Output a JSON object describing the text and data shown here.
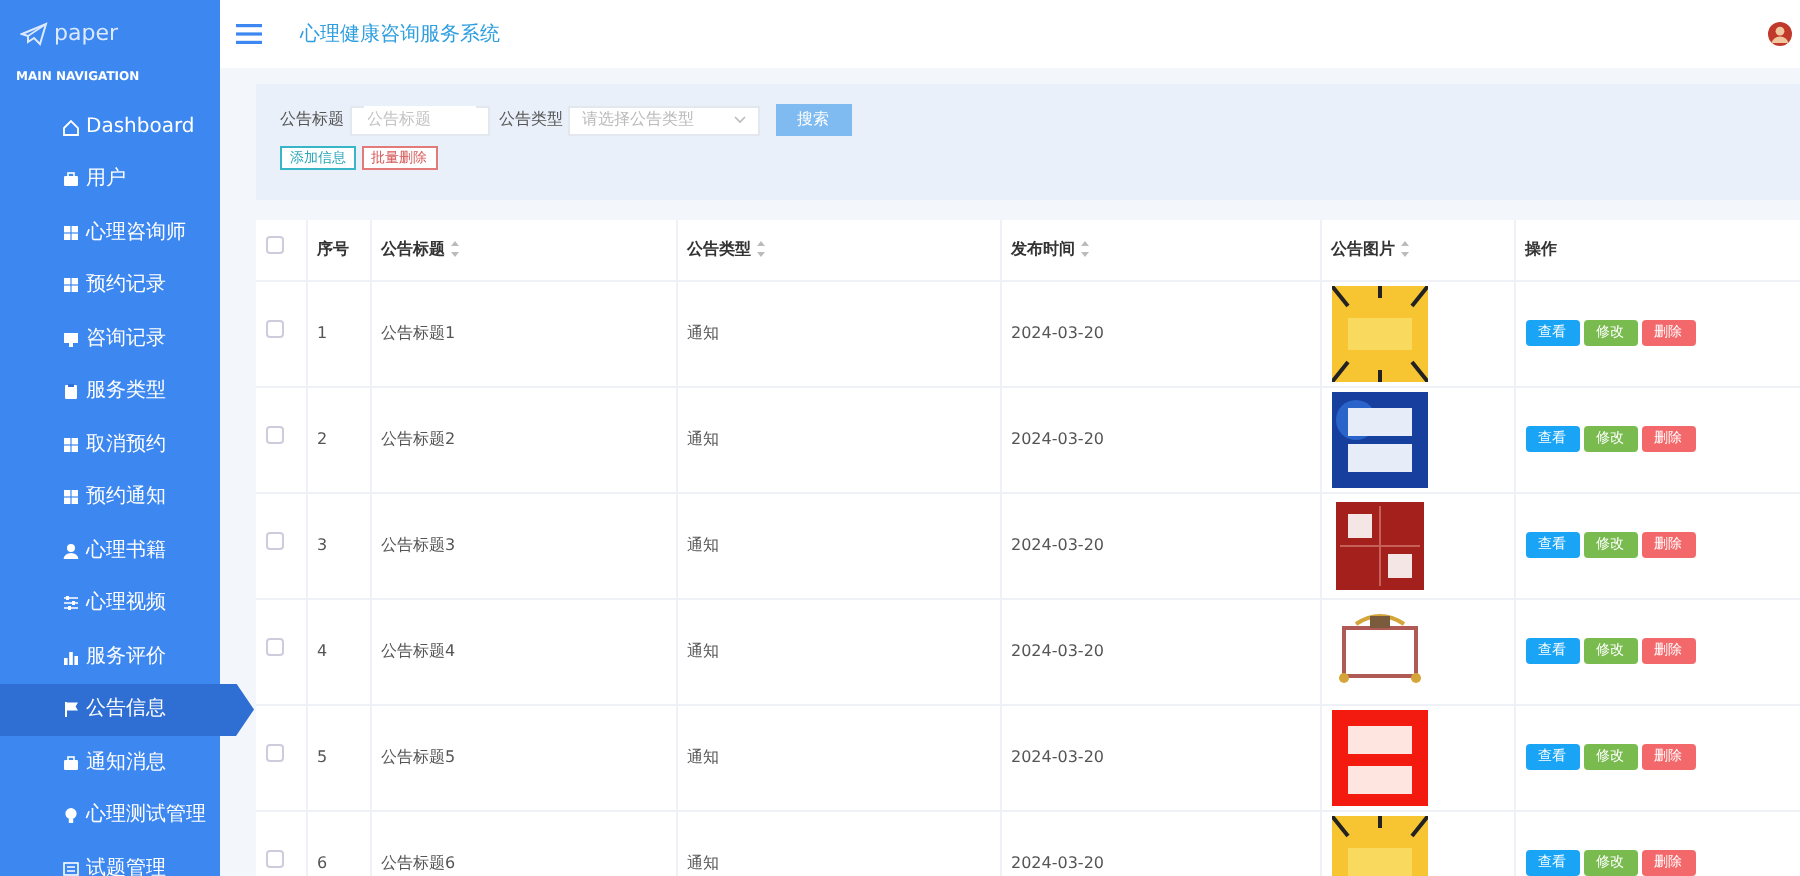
{
  "brand": "paper",
  "nav_heading": "MAIN NAVIGATION",
  "sidebar": {
    "items": [
      {
        "label": "Dashboard",
        "selected": false
      },
      {
        "label": "用户",
        "selected": false
      },
      {
        "label": "心理咨询师",
        "selected": false
      },
      {
        "label": "预约记录",
        "selected": false
      },
      {
        "label": "咨询记录",
        "selected": false
      },
      {
        "label": "服务类型",
        "selected": false
      },
      {
        "label": "取消预约",
        "selected": false
      },
      {
        "label": "预约通知",
        "selected": false
      },
      {
        "label": "心理书籍",
        "selected": false
      },
      {
        "label": "心理视频",
        "selected": false
      },
      {
        "label": "服务评价",
        "selected": false
      },
      {
        "label": "公告信息",
        "selected": true
      },
      {
        "label": "通知消息",
        "selected": false
      },
      {
        "label": "心理测试管理",
        "selected": false
      },
      {
        "label": "试题管理",
        "selected": false
      }
    ]
  },
  "header": {
    "title": "心理健康咨询服务系统"
  },
  "search": {
    "title_label": "公告标题",
    "title_placeholder": "公告标题",
    "type_label": "公告类型",
    "type_placeholder": "请选择公告类型",
    "search_button": "搜索",
    "add_button": "添加信息",
    "batch_delete_button": "批量删除"
  },
  "table": {
    "select_all_checked": false,
    "columns": [
      {
        "label": "序号",
        "sortable": false
      },
      {
        "label": "公告标题",
        "sortable": true
      },
      {
        "label": "公告类型",
        "sortable": true
      },
      {
        "label": "发布时间",
        "sortable": true
      },
      {
        "label": "公告图片",
        "sortable": true
      },
      {
        "label": "操作",
        "sortable": false
      }
    ],
    "rows": [
      {
        "checked": false,
        "no": "1",
        "title": "公告标题1",
        "type": "通知",
        "date": "2024-03-20",
        "actions": [
          "查看",
          "修改",
          "删除"
        ]
      },
      {
        "checked": false,
        "no": "2",
        "title": "公告标题2",
        "type": "通知",
        "date": "2024-03-20",
        "actions": [
          "查看",
          "修改",
          "删除"
        ]
      },
      {
        "checked": false,
        "no": "3",
        "title": "公告标题3",
        "type": "通知",
        "date": "2024-03-20",
        "actions": [
          "查看",
          "修改",
          "删除"
        ]
      },
      {
        "checked": false,
        "no": "4",
        "title": "公告标题4",
        "type": "通知",
        "date": "2024-03-20",
        "actions": [
          "查看",
          "修改",
          "删除"
        ]
      },
      {
        "checked": false,
        "no": "5",
        "title": "公告标题5",
        "type": "通知",
        "date": "2024-03-20",
        "actions": [
          "查看",
          "修改",
          "删除"
        ]
      },
      {
        "checked": false,
        "no": "6",
        "title": "公告标题6",
        "type": "通知",
        "date": "2024-03-20",
        "actions": [
          "查看",
          "修改",
          "删除"
        ]
      }
    ]
  }
}
